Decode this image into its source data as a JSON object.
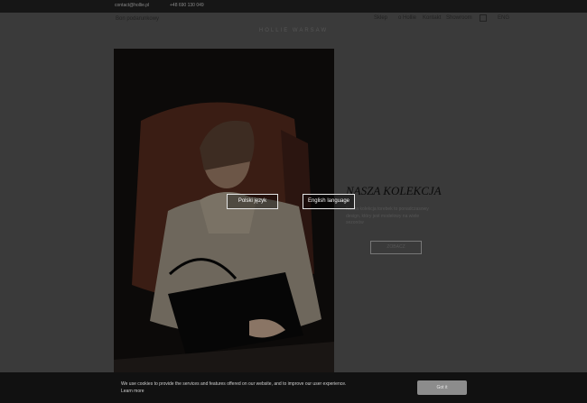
{
  "topbar": {
    "email": "contact@hollie.pl",
    "phone": "+48 690 130 049"
  },
  "header": {
    "left_link": "Bon podarunkowy",
    "brand": "HOLLIE WARSAW",
    "nav": [
      "Sklep",
      "o Hollie",
      "Kontakt",
      "Showroom"
    ],
    "lang_label": "ENG"
  },
  "hero": {
    "heading": "NASZA KOLEKCJA",
    "description": "Nasza kolekcja torebek to ponadczasowy design, który jest modelowy na wiele sezonów",
    "cta": "ZOBACZ"
  },
  "language_modal": {
    "polish": "Polski język",
    "english": "English language"
  },
  "cookie": {
    "text": "We use cookies to provide the services and features offered on our website, and to improve our user experience.",
    "learn_more": "Learn more",
    "button": "Got it"
  },
  "colors": {
    "overlay_bg": "#3a3a3a",
    "cookie_bar": "#111111",
    "got_it_button": "#8c8c8c"
  }
}
